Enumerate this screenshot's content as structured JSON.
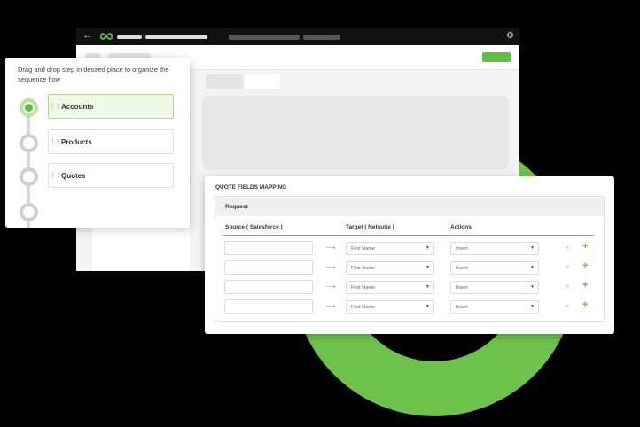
{
  "window": {
    "back_icon": "arrow-left-icon",
    "logo_icon": "infinity-icon",
    "settings_icon": "gear-icon",
    "accent": "#5fbf3f"
  },
  "steps_panel": {
    "hint": "Drag and drop step in desired place to organize the sequence flow",
    "items": [
      {
        "label": "Accounts",
        "active": true
      },
      {
        "label": "Products",
        "active": false
      },
      {
        "label": "Quotes",
        "active": false
      }
    ],
    "grip_icon": "drag-handle-icon"
  },
  "mapping": {
    "title": "QUOTE FIELDS MAPPING",
    "section": "Request",
    "columns": {
      "source": "Source ( Salesforce )",
      "target": "Target ( Netsuite )",
      "actions": "Actions"
    },
    "rows": [
      {
        "source": "",
        "target": "First Name",
        "action": "Insert"
      },
      {
        "source": "",
        "target": "First Name",
        "action": "Insert"
      },
      {
        "source": "",
        "target": "First Name",
        "action": "Insert"
      },
      {
        "source": "",
        "target": "First Name",
        "action": "Insert"
      }
    ],
    "arrow_glyph": "⟶",
    "remove_glyph": "×",
    "add_glyph": "+"
  }
}
